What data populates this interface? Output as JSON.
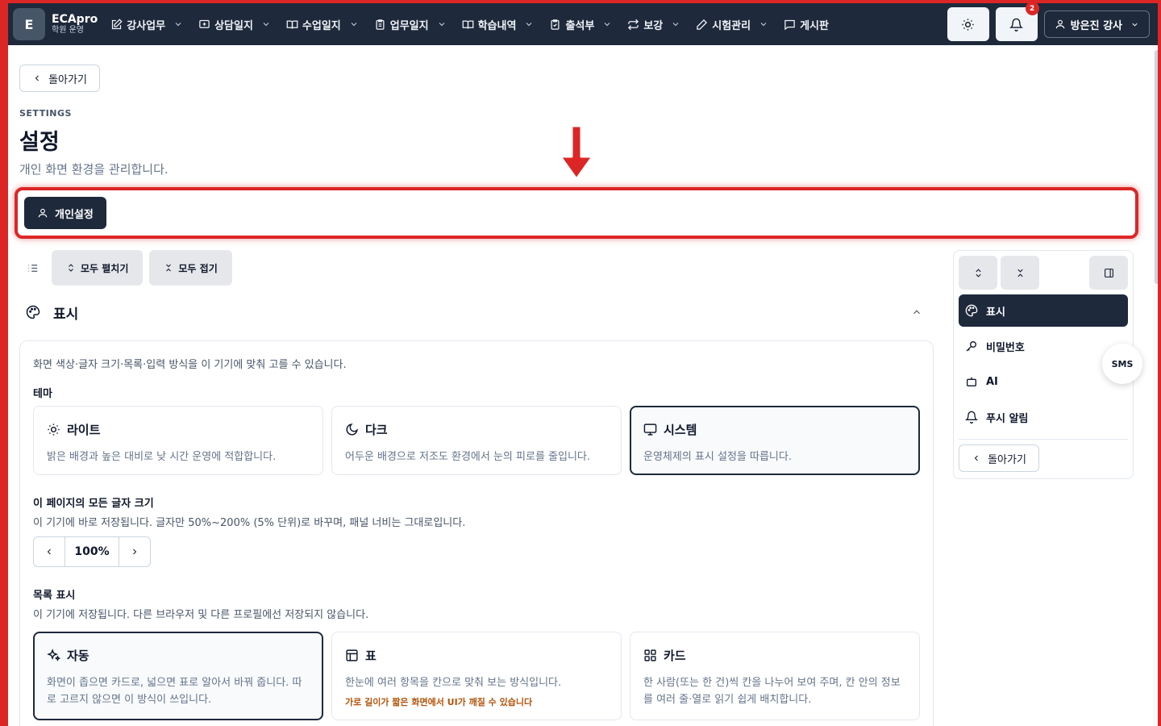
{
  "brand": {
    "logo_letter": "E",
    "name": "ECApro",
    "subtitle": "학원 운영"
  },
  "nav": {
    "items": [
      {
        "label": "강사업무"
      },
      {
        "label": "상담일지"
      },
      {
        "label": "수업일지"
      },
      {
        "label": "업무일지"
      },
      {
        "label": "학습내역"
      },
      {
        "label": "출석부"
      },
      {
        "label": "보강"
      },
      {
        "label": "시험관리"
      },
      {
        "label": "게시판"
      }
    ],
    "notification_count": "2",
    "user_label": "방은진 강사"
  },
  "page": {
    "back_label": "돌아가기",
    "eyebrow": "SETTINGS",
    "title": "설정",
    "subtitle": "개인 화면 환경을 관리합니다."
  },
  "tabs": {
    "active_label": "개인설정"
  },
  "toolbar": {
    "expand_all": "모두 펼치기",
    "collapse_all": "모두 접기"
  },
  "section": {
    "title": "표시",
    "description": "화면 색상·글자 크기·목록·입력 방식을 이 기기에 맞춰 고를 수 있습니다.",
    "theme_label": "테마",
    "themes": [
      {
        "title": "라이트",
        "desc": "밝은 배경과 높은 대비로 낮 시간 운영에 적합합니다."
      },
      {
        "title": "다크",
        "desc": "어두운 배경으로 저조도 환경에서 눈의 피로를 줄입니다."
      },
      {
        "title": "시스템",
        "desc": "운영체제의 표시 설정을 따릅니다."
      }
    ],
    "font_label": "이 페이지의 모든 글자 크기",
    "font_help": "이 기기에 바로 저장됩니다. 글자만 50%~200% (5% 단위)로 바꾸며, 패널 너비는 그대로입니다.",
    "font_value": "100%",
    "list_label": "목록 표시",
    "list_help": "이 기기에 저장됩니다. 다른 브라우저 및 다른 프로필에선 저장되지 않습니다.",
    "list_modes": [
      {
        "title": "자동",
        "desc": "화면이 좁으면 카드로, 넓으면 표로 알아서 바꿔 줍니다. 따로 고르지 않으면 이 방식이 쓰입니다."
      },
      {
        "title": "표",
        "desc": "한눈에 여러 항목을 칸으로 맞춰 보는 방식입니다.",
        "warn": "가로 길이가 짧은 화면에서 UI가 깨질 수 있습니다"
      },
      {
        "title": "카드",
        "desc": "한 사람(또는 한 건)씩 칸을 나누어 보여 주며, 칸 안의 정보를 여러 줄·열로 읽기 쉽게 배치합니다."
      }
    ]
  },
  "side_nav": {
    "items": [
      {
        "label": "표시"
      },
      {
        "label": "비밀번호"
      },
      {
        "label": "AI"
      },
      {
        "label": "푸시 알림"
      }
    ],
    "back_label": "돌아가기",
    "sms_label": "SMS"
  }
}
